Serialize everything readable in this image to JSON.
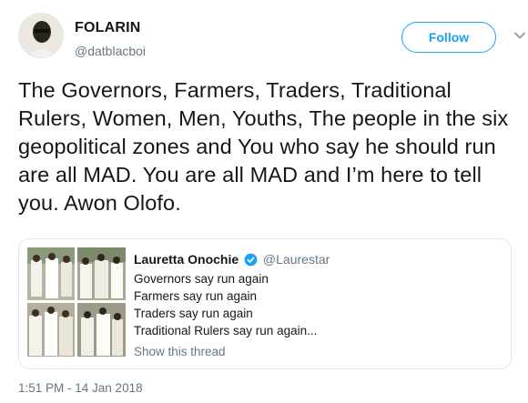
{
  "author": {
    "name": "FOLARIN",
    "handle": "@datblacboi"
  },
  "follow_label": "Follow",
  "tweet_text": "The Governors, Farmers, Traders, Traditional Rulers, Women, Men, Youths, The people in the six geopolitical zones and You who say he should run are all MAD. You are all MAD and I’m here to tell you. Awon Olofo.",
  "quoted": {
    "name": "Lauretta Onochie",
    "handle": "@Laurestar",
    "lines": [
      "Governors say run again",
      "Farmers say run again",
      "Traders say run again",
      "Traditional Rulers say run again..."
    ],
    "show_thread": "Show this thread"
  },
  "timestamp": "1:51 PM - 14 Jan 2018",
  "colors": {
    "accent": "#1da1f2",
    "text": "#14171a",
    "muted": "#657786",
    "border": "#e1e8ed"
  },
  "icons": {
    "caret": "chevron-down-icon",
    "verified": "verified-badge-icon"
  }
}
